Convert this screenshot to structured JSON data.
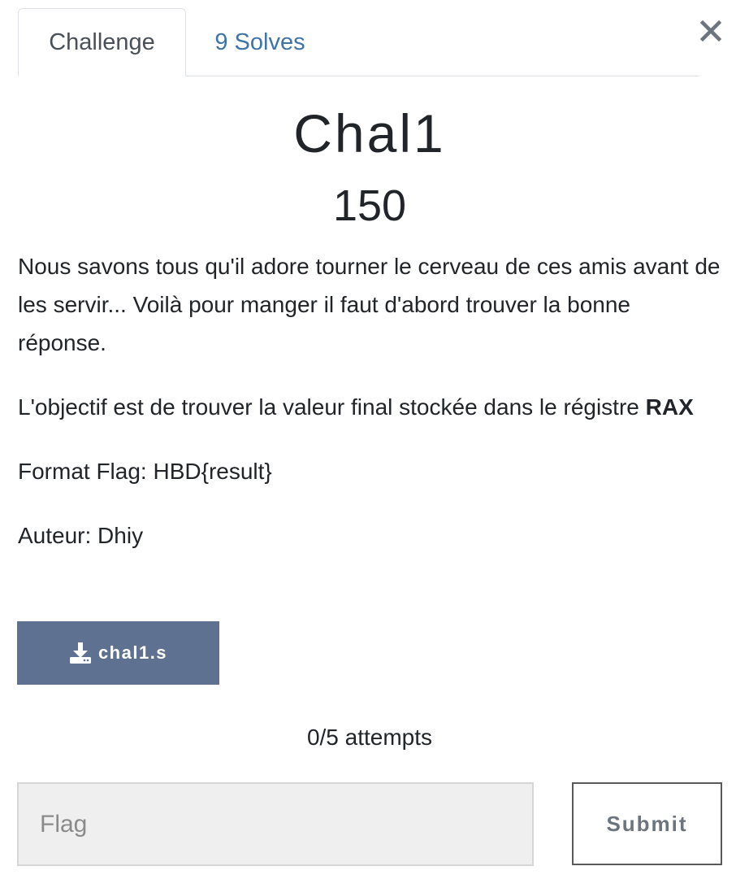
{
  "tabs": [
    {
      "label": "Challenge",
      "active": true
    },
    {
      "label": "9 Solves",
      "active": false
    }
  ],
  "close_icon": "close-icon",
  "challenge": {
    "name": "Chal1",
    "points": "150",
    "description": {
      "paragraph1": "Nous savons tous qu'il adore tourner le cerveau de ces amis avant de les servir... Voilà pour manger il faut d'abord trouver la bonne réponse.",
      "paragraph2_text": "L'objectif est de trouver la valeur final stockée dans le régistre ",
      "paragraph2_bold": "RAX",
      "paragraph3": "Format Flag: HBD{result}",
      "paragraph4": "Auteur: Dhiy"
    },
    "file": {
      "label": "chal1.s",
      "icon": "download-icon"
    },
    "attempts": "0/5 attempts"
  },
  "form": {
    "flag_placeholder": "Flag",
    "flag_value": "",
    "submit_label": "Submit"
  },
  "colors": {
    "tab_link": "#3f74ab",
    "download_button": "#5f7190",
    "input_background": "#efefef"
  }
}
